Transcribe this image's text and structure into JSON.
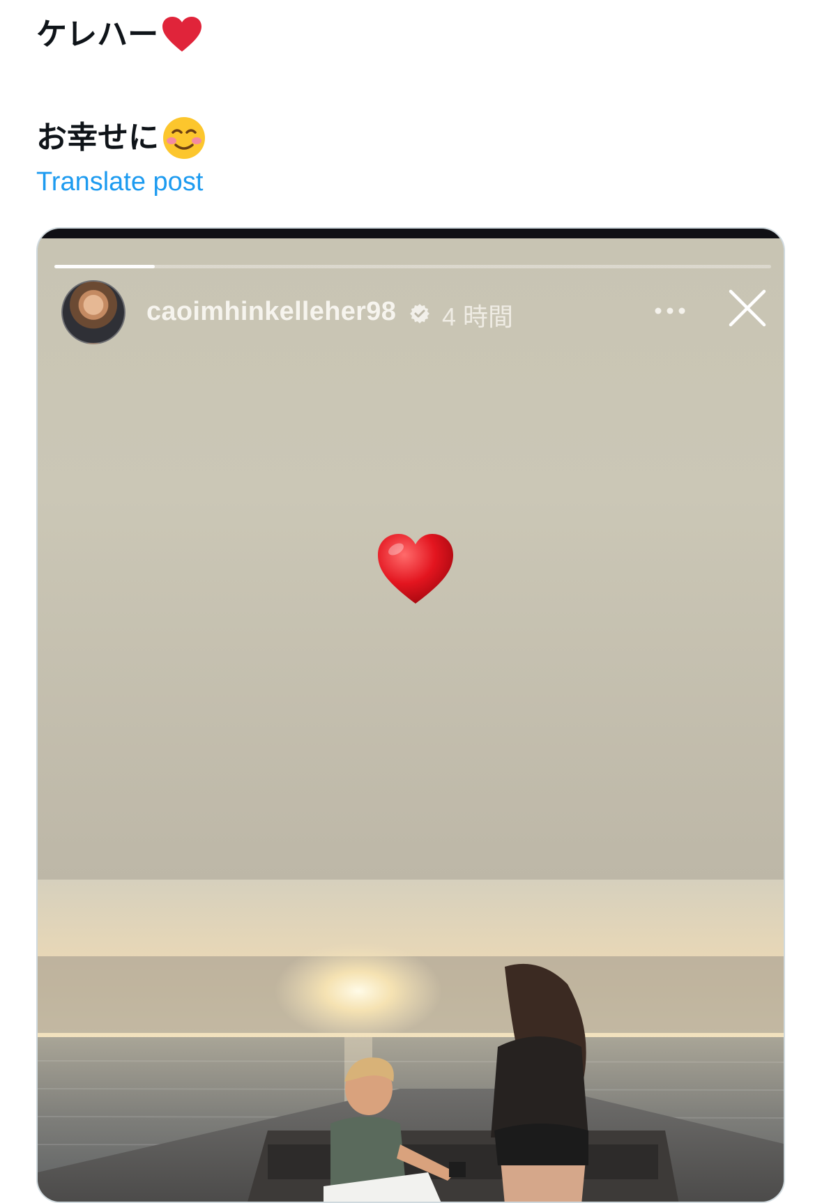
{
  "post": {
    "line1": "ケレハー",
    "line1_emoji": "red-heart",
    "line2": "お幸せに",
    "line2_emoji": "smiling-face-with-blush",
    "translate_label": "Translate post"
  },
  "story": {
    "username": "caoimhinkelleher98",
    "time": "4 時間",
    "verified": true,
    "progress": 0.14,
    "sticker": "red-heart",
    "photo_subject": "proposal-on-boat-at-sunset"
  },
  "colors": {
    "link": "#1d9bf0",
    "heart": "#e11d2a",
    "story_bg": "#c8c4b3"
  }
}
